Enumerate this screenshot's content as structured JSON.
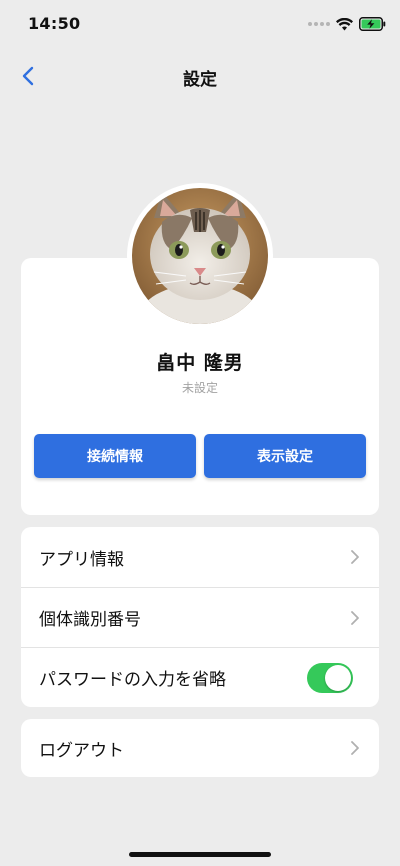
{
  "status_bar": {
    "time": "14:50",
    "icons": [
      "signal-dots-icon",
      "wifi-icon",
      "battery-charging-icon"
    ],
    "battery_color": "#35c95a"
  },
  "nav": {
    "title": "設定",
    "back_icon": "chevron-left-icon"
  },
  "profile": {
    "name": "畠中 隆男",
    "subtitle": "未設定",
    "avatar": "cat-photo",
    "buttons": {
      "connection": "接続情報",
      "display": "表示設定"
    }
  },
  "settings": {
    "items": [
      {
        "label": "アプリ情報",
        "control": "chevron-right-icon"
      },
      {
        "label": "個体識別番号",
        "control": "chevron-right-icon"
      },
      {
        "label": "パスワードの入力を省略",
        "control": "toggle",
        "on": true
      }
    ],
    "logout": {
      "label": "ログアウト",
      "control": "chevron-right-icon"
    }
  },
  "colors": {
    "accent": "#2f6fe0",
    "toggle_on": "#35c95a",
    "background": "#ececec"
  }
}
